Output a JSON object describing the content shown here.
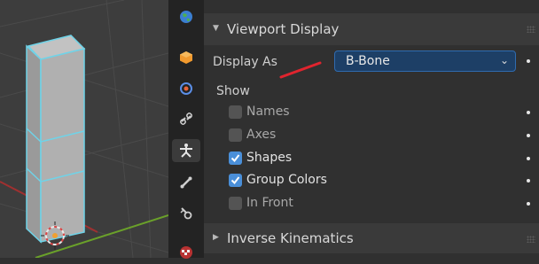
{
  "viewport_display": {
    "title": "Viewport Display",
    "display_as_label": "Display As",
    "display_as_value": "B-Bone",
    "show_label": "Show",
    "options": [
      {
        "label": "Names",
        "checked": false
      },
      {
        "label": "Axes",
        "checked": false
      },
      {
        "label": "Shapes",
        "checked": true
      },
      {
        "label": "Group Colors",
        "checked": true
      },
      {
        "label": "In Front",
        "checked": false
      }
    ]
  },
  "inverse_kinematics": {
    "title": "Inverse Kinematics"
  },
  "sidebar_tabs": [
    "world-icon",
    "object-icon",
    "physics-icon",
    "constraints-icon",
    "armature-data-icon",
    "bone-icon",
    "bone-constraint-icon",
    "material-icon"
  ],
  "colors": {
    "selected_dropdown": "#1d3f66",
    "checkbox_on": "#4a8fd9",
    "annotation_arrow": "#e0242e",
    "selection_outline": "#6fd3e8",
    "x_axis": "#a03030",
    "y_axis": "#6aa02a"
  }
}
